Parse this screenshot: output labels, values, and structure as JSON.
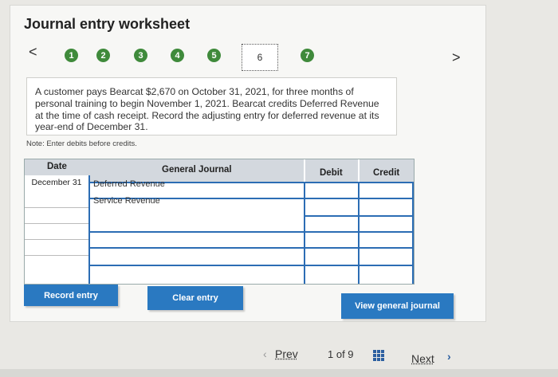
{
  "header": {
    "title": "Journal entry worksheet"
  },
  "nav": {
    "prev_chevron": "<",
    "next_chevron": ">",
    "steps": [
      "1",
      "2",
      "3",
      "4",
      "5",
      "6",
      "7"
    ],
    "current_step": "6"
  },
  "prompt": {
    "text": "A customer pays Bearcat $2,670 on October 31, 2021, for three months of personal training to begin November 1, 2021. Bearcat credits Deferred Revenue at the time of cash receipt. Record the adjusting entry for deferred revenue at its year-end of December 31.",
    "note": "Note: Enter debits before credits."
  },
  "table": {
    "headers": {
      "date": "Date",
      "account": "General Journal",
      "debit": "Debit",
      "credit": "Credit"
    },
    "rows": [
      {
        "date": "December 31",
        "account": "Deferred Revenue",
        "debit": "",
        "credit": ""
      },
      {
        "date": "",
        "account": "Service Revenue",
        "debit": "",
        "credit": ""
      },
      {
        "date": "",
        "account": "",
        "debit": "",
        "credit": ""
      },
      {
        "date": "",
        "account": "",
        "debit": "",
        "credit": ""
      },
      {
        "date": "",
        "account": "",
        "debit": "",
        "credit": ""
      },
      {
        "date": "",
        "account": "",
        "debit": "",
        "credit": ""
      }
    ]
  },
  "buttons": {
    "record": "Record entry",
    "clear": "Clear entry",
    "view": "View general journal"
  },
  "pager": {
    "prev": "Prev",
    "position": "1 of 9",
    "next": "Next"
  },
  "colors": {
    "step_green": "#3f8a3b",
    "button_blue": "#2a79c1",
    "grid_blue": "#2c6db4"
  }
}
